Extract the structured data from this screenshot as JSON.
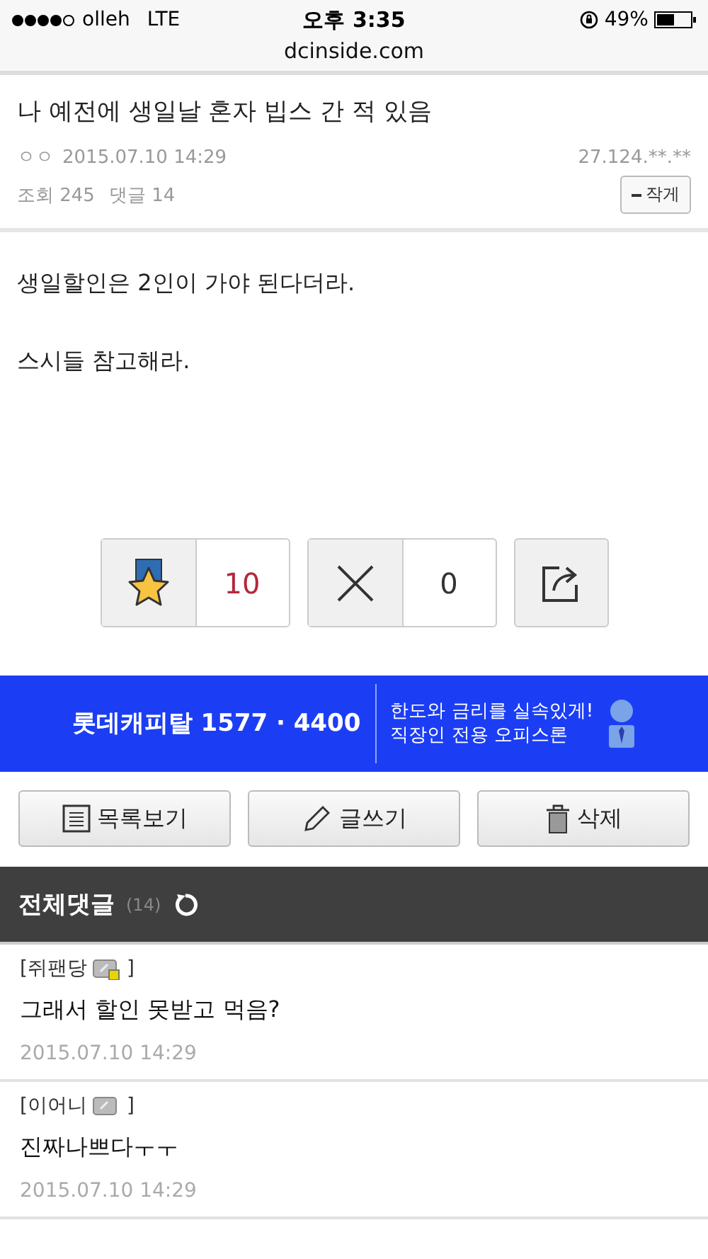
{
  "status_bar": {
    "carrier": "olleh",
    "network": "LTE",
    "time": "오후 3:35",
    "battery": "49%"
  },
  "address": "dcinside.com",
  "post": {
    "title": "나 예전에 생일날 혼자 빕스 간 적 있음",
    "author": "ㅇㅇ",
    "date": "2015.07.10 14:29",
    "ip": "27.124.**.**",
    "views_label": "조회",
    "views": "245",
    "comments_label": "댓글",
    "comments": "14",
    "shrink_button": "작게",
    "body": [
      "생일할인은 2인이 가야 된다더라.",
      "스시들 참고해라."
    ]
  },
  "votes": {
    "recommend": "10",
    "oppose": "0"
  },
  "ad": {
    "main": "롯데캐피탈 1577 · 4400",
    "line1": "한도와 금리를 실속있게!",
    "line2": "직장인 전용 오피스론"
  },
  "actions": [
    {
      "kind": "list",
      "label": "목록보기"
    },
    {
      "kind": "write",
      "label": "글쓰기"
    },
    {
      "kind": "delete",
      "label": "삭제"
    }
  ],
  "comments_header": {
    "title": "전체댓글",
    "count": "(14)"
  },
  "comments": [
    {
      "author": "[쥐팬당",
      "author_end": "]",
      "locked": true,
      "text": "그래서 할인 못받고 먹음?",
      "date": "2015.07.10 14:29"
    },
    {
      "author": "[이어니",
      "author_end": "]",
      "locked": false,
      "text": "진짜나쁘다ㅜㅜ",
      "date": "2015.07.10 14:29"
    }
  ]
}
